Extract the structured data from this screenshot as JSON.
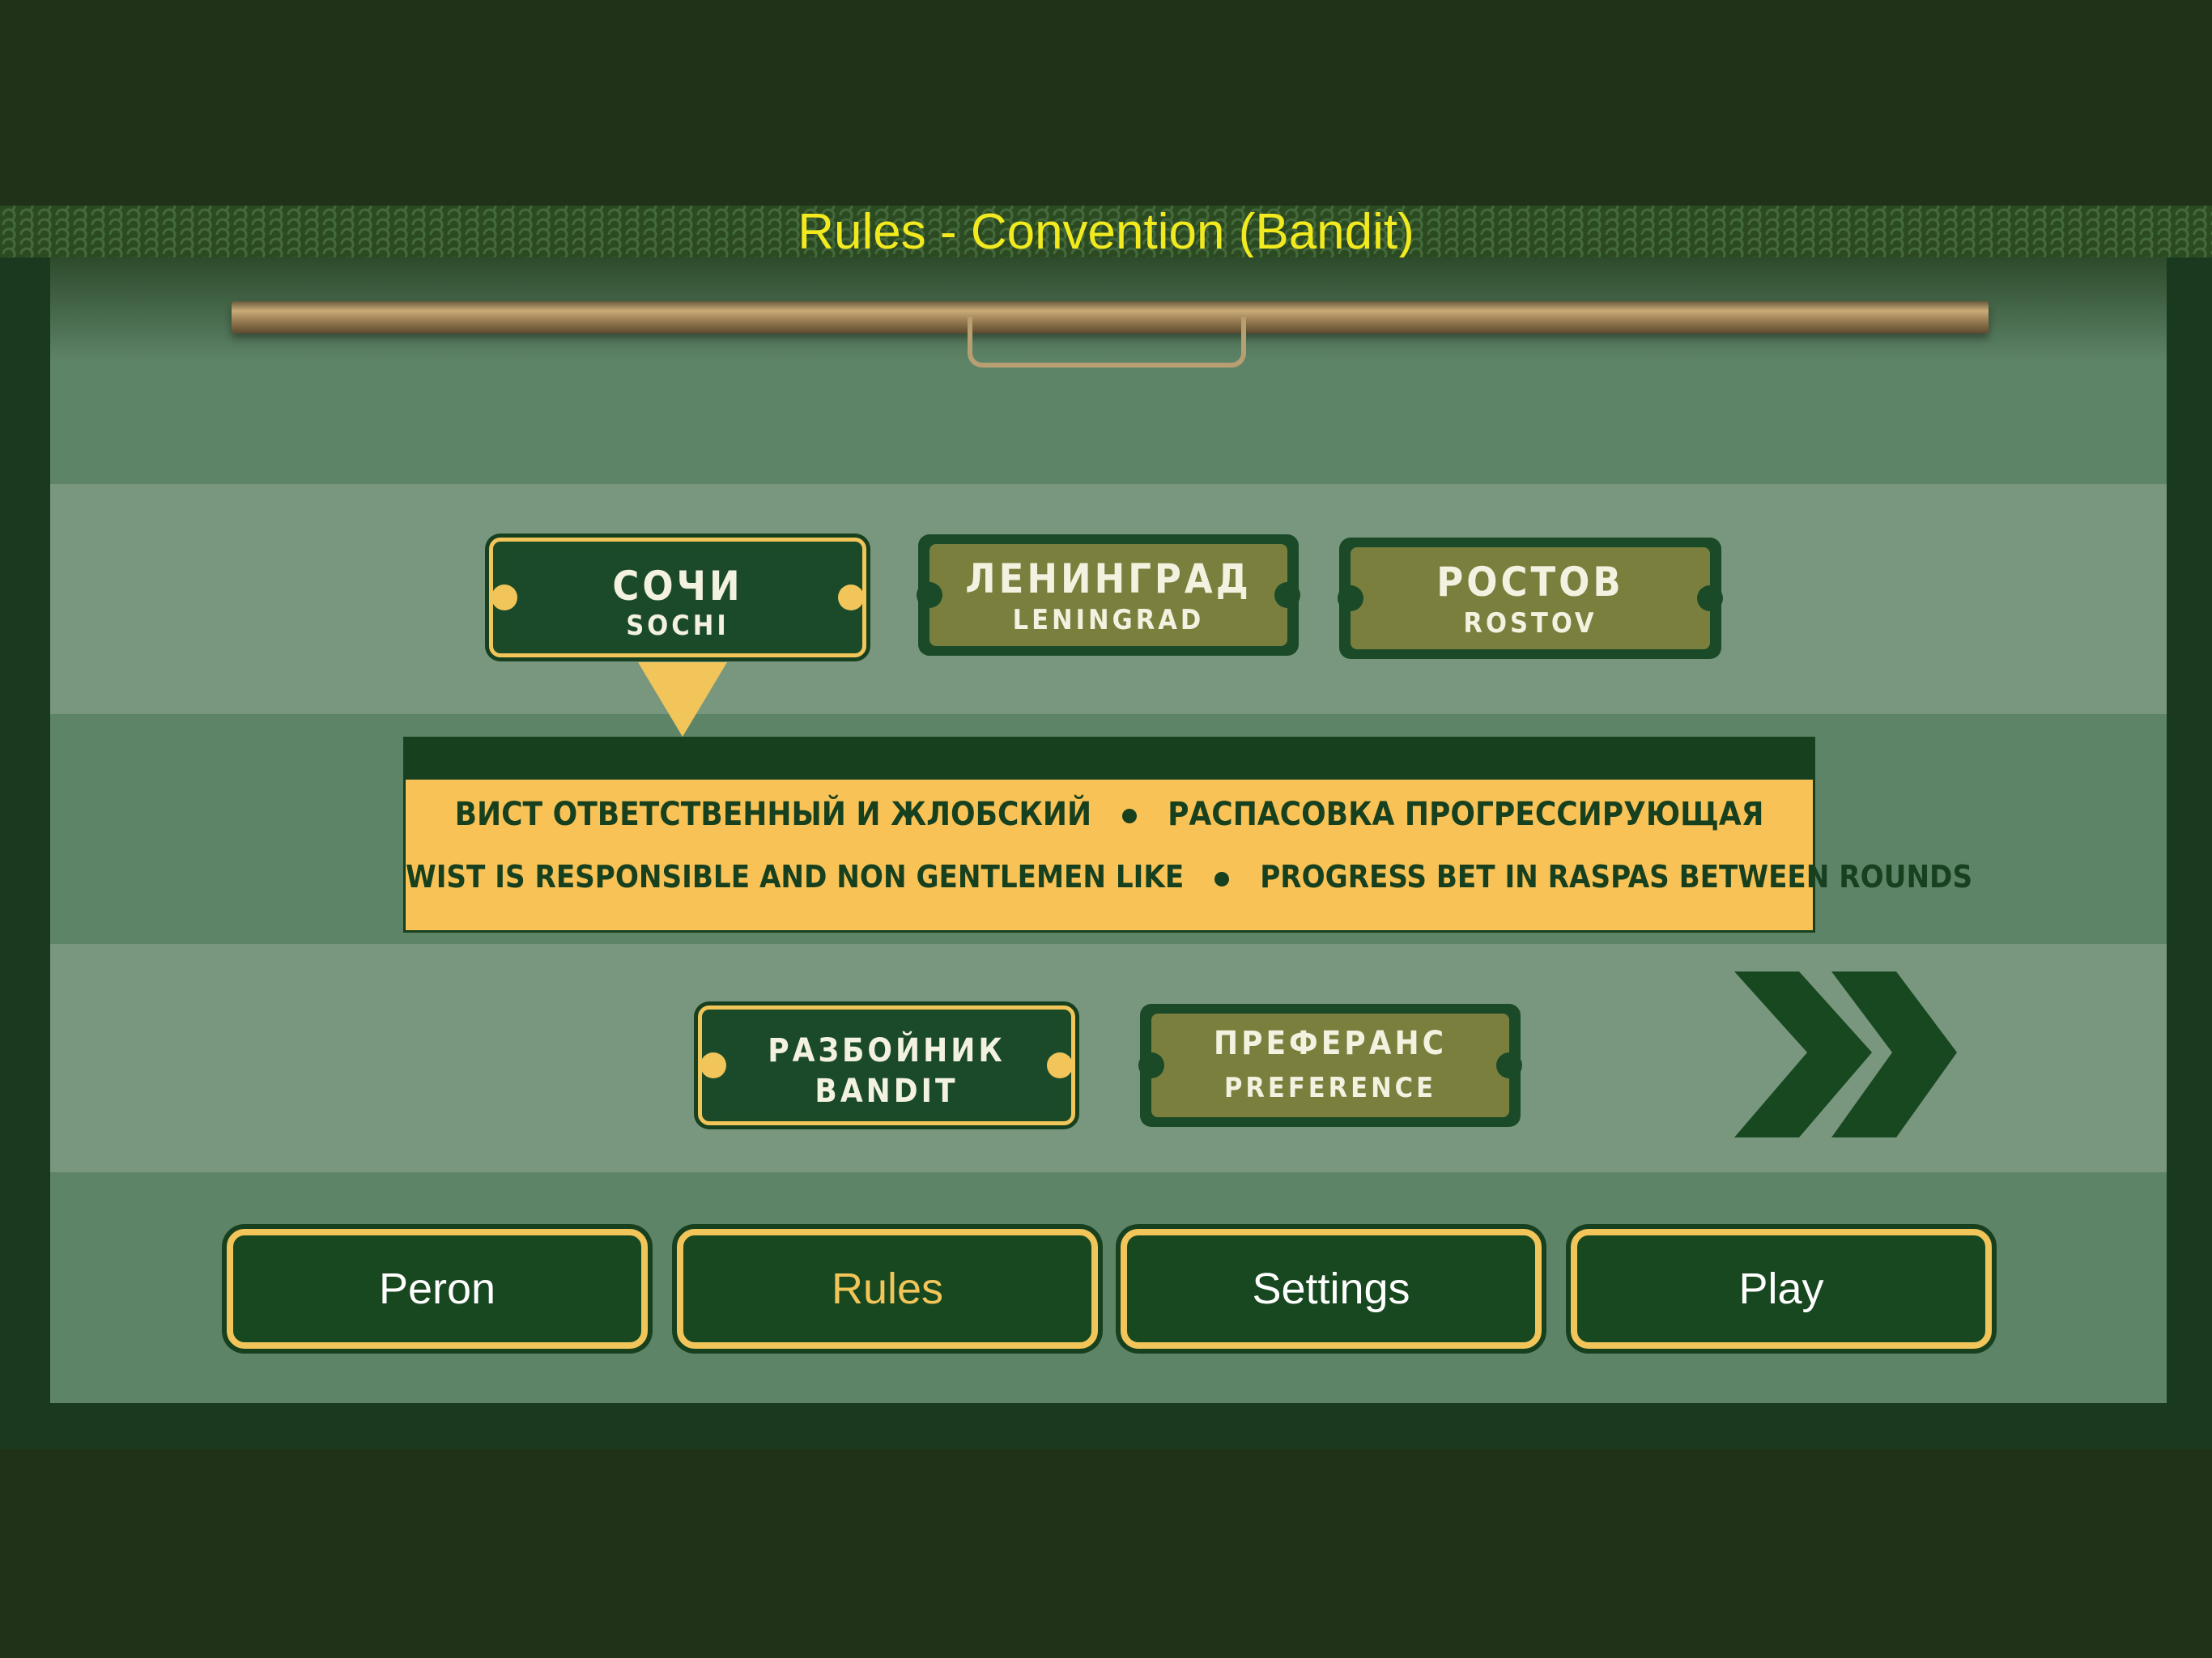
{
  "header": {
    "title": "Rules - Convention (Bandit)"
  },
  "conventions": [
    {
      "label_ru": "СОЧИ",
      "label_en": "SOCHI",
      "selected": true
    },
    {
      "label_ru": "ЛЕНИНГРАД",
      "label_en": "LENINGRAD",
      "selected": false
    },
    {
      "label_ru": "РОСТОВ",
      "label_en": "ROSTOV",
      "selected": false
    }
  ],
  "description": {
    "ru_left": "ВИСТ ОТВЕТСТВЕННЫЙ И ЖЛОБСКИЙ",
    "ru_right": "РАСПАСОВКА ПРОГРЕССИРУЮЩАЯ",
    "en_left": "WIST IS RESPONSIBLE AND NON GENTLEMEN LIKE",
    "en_right": "PROGRESS BET IN RASPAS BETWEEN ROUNDS"
  },
  "game_modes": [
    {
      "label_ru": "РАЗБОЙНИК",
      "label_en": "BANDIT",
      "selected": true
    },
    {
      "label_ru": "ПРЕФЕРАНС",
      "label_en": "PREFERENCE",
      "selected": false
    }
  ],
  "next_icon": "double-chevron-right-icon",
  "nav": [
    {
      "label": "Peron",
      "active": false
    },
    {
      "label": "Rules",
      "active": true
    },
    {
      "label": "Settings",
      "active": false
    },
    {
      "label": "Play",
      "active": false
    }
  ],
  "colors": {
    "title": "#f2ea1e",
    "accent": "#f2c55a",
    "button_bg": "#17481f",
    "inactive_ticket": "#7a7f3e",
    "panel": "#5e8468",
    "band": "#79977f"
  }
}
